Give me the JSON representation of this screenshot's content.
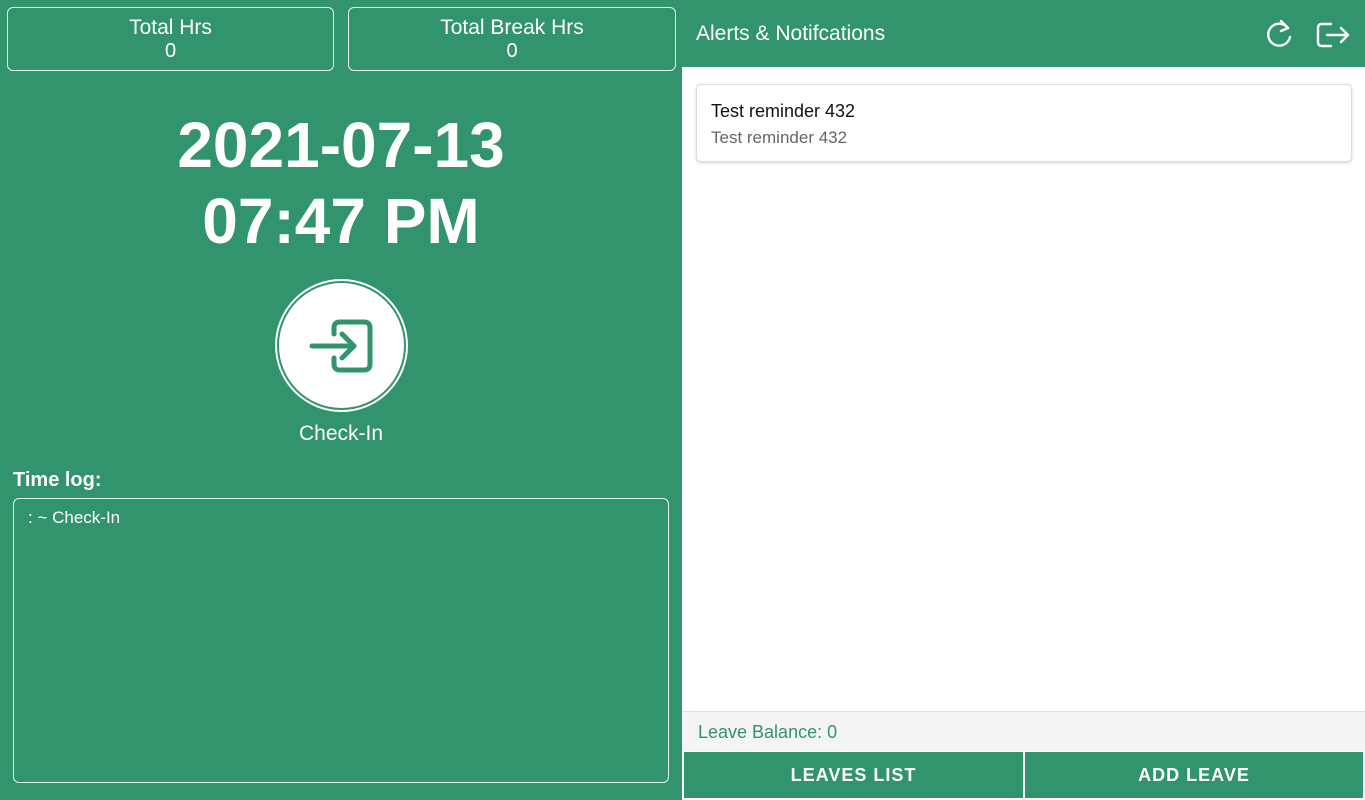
{
  "stats": {
    "total_hrs_label": "Total Hrs",
    "total_hrs_value": "0",
    "total_break_label": "Total Break Hrs",
    "total_break_value": "0"
  },
  "clock": {
    "date": "2021-07-13",
    "time": "07:47 PM"
  },
  "checkin": {
    "label": "Check-In",
    "icon": "login-icon"
  },
  "timelog": {
    "title": "Time log:",
    "entries": [
      ": ~ Check-In"
    ]
  },
  "alerts": {
    "title": "Alerts & Notifcations",
    "refresh_icon": "refresh-icon",
    "logout_icon": "logout-icon",
    "items": [
      {
        "title": "Test reminder 432",
        "body": "Test reminder 432"
      }
    ]
  },
  "leave": {
    "balance_text": "Leave Balance: 0",
    "leaves_list_label": "LEAVES LIST",
    "add_leave_label": "ADD LEAVE"
  },
  "colors": {
    "primary": "#31946c",
    "background": "#ffffff",
    "muted_text": "#666666"
  }
}
